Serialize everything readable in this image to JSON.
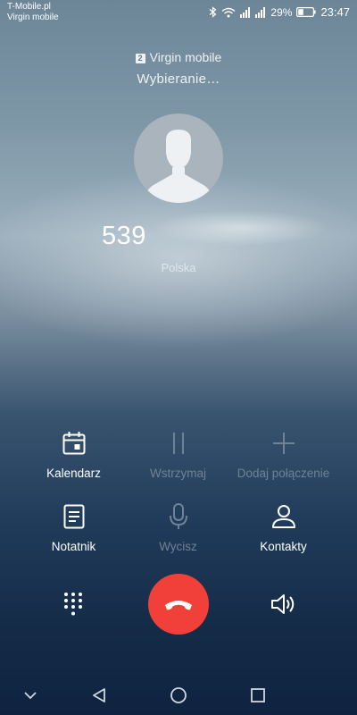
{
  "status_bar": {
    "carrier_1": "T-Mobile.pl",
    "carrier_2": "Virgin mobile",
    "battery_percent": "29%",
    "time": "23:47"
  },
  "call": {
    "sim_number": "2",
    "sim_carrier": "Virgin mobile",
    "state": "Wybieranie…",
    "number": "539",
    "location": "Polska"
  },
  "actions": {
    "calendar": "Kalendarz",
    "hold": "Wstrzymaj",
    "add_call": "Dodaj połączenie",
    "notes": "Notatnik",
    "mute": "Wycisz",
    "contacts": "Kontakty"
  },
  "colors": {
    "end_call": "#f1403a",
    "disabled_label": "#6f8296"
  },
  "icons": {
    "dialpad": "dialpad-icon",
    "end_call": "end-call-icon",
    "speaker": "speaker-icon",
    "nav_back": "triangle-back-icon",
    "nav_home": "circle-home-icon",
    "nav_recents": "square-recents-icon",
    "nav_hide": "chevron-down-icon"
  }
}
